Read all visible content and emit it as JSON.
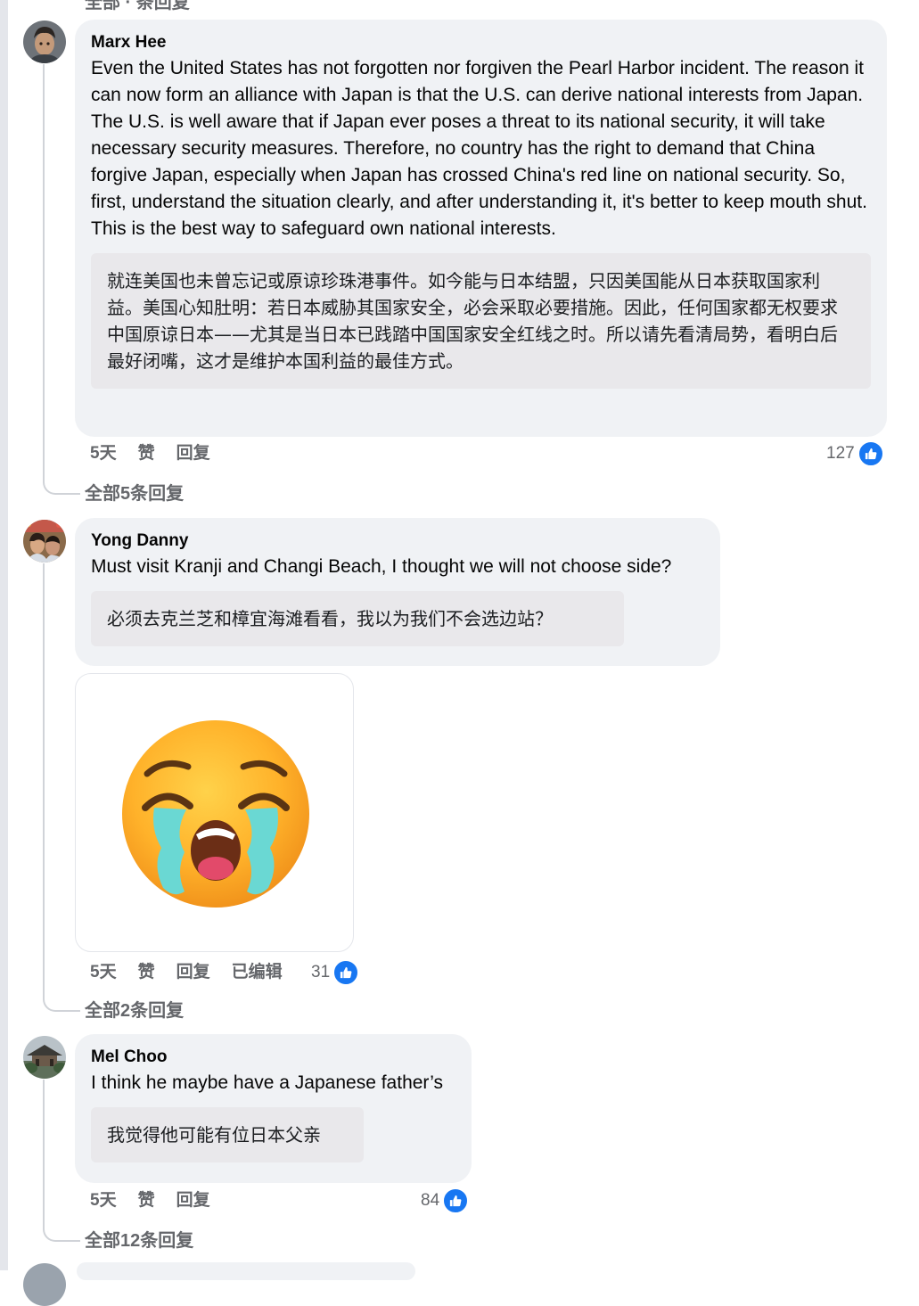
{
  "top_partial_text": "全部... 条回复",
  "comments": [
    {
      "author": "Marx Hee",
      "text": "Even the United States has not forgotten nor forgiven the Pearl Harbor incident. The reason it can now form an alliance with Japan is that the U.S. can derive national interests from Japan. The U.S. is well aware that if Japan ever poses a threat to its national security, it will take necessary security measures. Therefore, no country has the right to demand that China forgive Japan, especially when Japan has crossed China's red line on national security. So, first, understand the situation clearly, and after understanding it, it's better to keep mouth shut. This is the best way to safeguard own national interests.",
      "translation": "就连美国也未曾忘记或原谅珍珠港事件。如今能与日本结盟，只因美国能从日本获取国家利益。美国心知肚明：若日本威胁其国家安全，必会采取必要措施。因此，任何国家都无权要求中国原谅日本——尤其是当日本已践踏中国国家安全红线之时。所以请先看清局势，看明白后最好闭嘴，这才是维护本国利益的最佳方式。",
      "time": "5天",
      "like_label": "赞",
      "reply_label": "回复",
      "likes": "127",
      "view_replies": "全部5条回复"
    },
    {
      "author": "Yong Danny",
      "text": "Must visit Kranji and Changi Beach, I thought we will not choose side?",
      "translation": "必须去克兰芝和樟宜海滩看看，我以为我们不会选边站？",
      "time": "5天",
      "like_label": "赞",
      "reply_label": "回复",
      "edited_label": "已编辑",
      "likes": "31",
      "sticker": "loudly-crying-face",
      "view_replies": "全部2条回复"
    },
    {
      "author": "Mel Choo",
      "text": "I think he maybe have a Japanese father’s",
      "translation": "我觉得他可能有位日本父亲",
      "time": "5天",
      "like_label": "赞",
      "reply_label": "回复",
      "likes": "84",
      "view_replies": "全部12条回复"
    }
  ],
  "colors": {
    "bubble": "#f0f2f5",
    "translation_bg": "#e9e8eb",
    "meta_text": "#65676b",
    "like_blue": "#1877f2"
  }
}
